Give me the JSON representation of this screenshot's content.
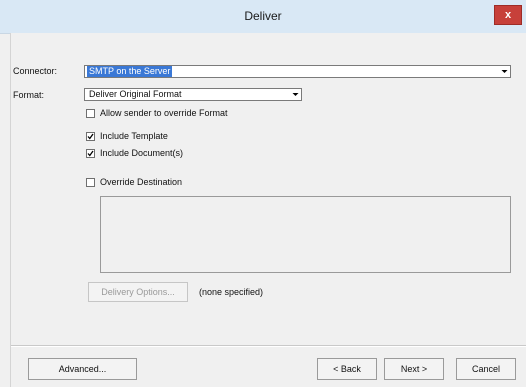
{
  "window": {
    "title": "Deliver",
    "close_glyph": "x"
  },
  "form": {
    "connector_label": "Connector:",
    "connector_value": "SMTP on the Server",
    "format_label": "Format:",
    "format_value": "Deliver Original Format",
    "allow_override_label": "Allow sender to override Format",
    "allow_override_checked": false,
    "include_template_label": "Include Template",
    "include_template_checked": true,
    "include_documents_label": "Include Document(s)",
    "include_documents_checked": true,
    "override_destination_label": "Override Destination",
    "override_destination_checked": false,
    "destination_text": "",
    "delivery_options_label": "Delivery Options...",
    "delivery_status": "(none specified)"
  },
  "footer": {
    "advanced_label": "Advanced...",
    "back_label": "< Back",
    "next_label": "Next >",
    "cancel_label": "Cancel"
  },
  "icons": {
    "dropdown": "chevron-down-icon",
    "check": "check-icon",
    "close": "close-icon"
  },
  "colors": {
    "titlebar": "#d9e8f5",
    "selection": "#3a78d6",
    "close": "#c7403a"
  }
}
